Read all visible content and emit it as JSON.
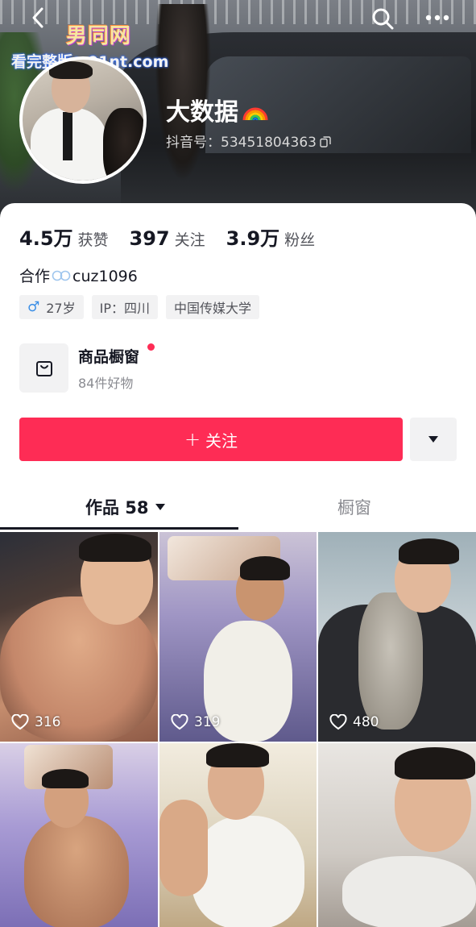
{
  "header": {
    "watermark_logo": "男同网",
    "watermark_url": "看完整版：91nt.com",
    "nickname": "大数据",
    "douyin_id": "抖音号：53451804363"
  },
  "stats": [
    {
      "num": "4.5万",
      "label": "获赞"
    },
    {
      "num": "397",
      "label": "关注"
    },
    {
      "num": "3.9万",
      "label": "粉丝"
    }
  ],
  "bio": {
    "prefix": "合作",
    "contact": "cuz1096"
  },
  "tags": {
    "gender_symbol": "♂",
    "age": "27岁",
    "ip": "IP：四川",
    "school": "中国传媒大学"
  },
  "shop": {
    "title": "商品橱窗",
    "subtitle": "84件好物"
  },
  "actions": {
    "follow_plus": "+",
    "follow_label": "关注"
  },
  "tabs": {
    "works_label": "作品 58",
    "showcase_label": "橱窗"
  },
  "videos": [
    {
      "likes": "316"
    },
    {
      "likes": "319"
    },
    {
      "likes": "480"
    },
    {
      "likes": ""
    },
    {
      "likes": ""
    },
    {
      "likes": ""
    }
  ],
  "colors": {
    "accent": "#fe2c55",
    "male": "#3a8ee6",
    "text": "#161823",
    "muted": "#8a8b91"
  }
}
